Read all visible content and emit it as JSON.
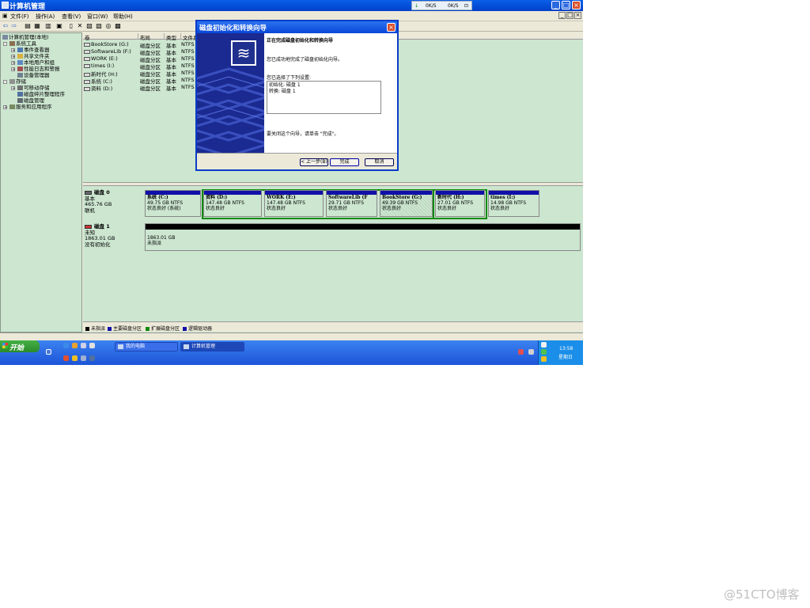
{
  "window": {
    "title": "计算机管理",
    "min_label": "_",
    "max_label": "□",
    "close_label": "×",
    "netmon": {
      "down": "0K/S",
      "up": "0K/S"
    }
  },
  "menu": [
    "文件(F)",
    "操作(A)",
    "查看(V)",
    "窗口(W)",
    "帮助(H)"
  ],
  "tree": {
    "root": "计算机管理(本地)",
    "system_tools": "系统工具",
    "event_viewer": "事件查看器",
    "shared_folders": "共享文件夹",
    "local_users": "本地用户和组",
    "perf_logs": "性能日志和警报",
    "device_manager": "设备管理器",
    "storage": "存储",
    "removable_storage": "可移动存储",
    "defrag": "磁盘碎片整理程序",
    "disk_mgmt": "磁盘管理",
    "services": "服务和应用程序"
  },
  "volume_list": {
    "columns": [
      "卷",
      "布局",
      "类型",
      "文件系"
    ],
    "rows": [
      {
        "name": "BookStore (G:)",
        "layout": "磁盘分区",
        "type": "基本",
        "fs": "NTFS"
      },
      {
        "name": "SoftwareLib (F:)",
        "layout": "磁盘分区",
        "type": "基本",
        "fs": "NTFS"
      },
      {
        "name": "WORK (E:)",
        "layout": "磁盘分区",
        "type": "基本",
        "fs": "NTFS"
      },
      {
        "name": "times (I:)",
        "layout": "磁盘分区",
        "type": "基本",
        "fs": "NTFS"
      },
      {
        "name": "新时代 (H:)",
        "layout": "磁盘分区",
        "type": "基本",
        "fs": "NTFS"
      },
      {
        "name": "系统 (C:)",
        "layout": "磁盘分区",
        "type": "基本",
        "fs": "NTFS"
      },
      {
        "name": "资料 (D:)",
        "layout": "磁盘分区",
        "type": "基本",
        "fs": "NTFS"
      }
    ]
  },
  "disk0": {
    "name": "磁盘 0",
    "kind": "基本",
    "size": "465.76 GB",
    "state": "联机",
    "partitions": [
      {
        "name": "系统  (C:)",
        "size": "49.75 GB NTFS",
        "status": "状态良好 (系统)"
      },
      {
        "name": "资料  (D:)",
        "size": "147.48 GB NTFS",
        "status": "状态良好"
      },
      {
        "name": "WORK  (E:)",
        "size": "147.48 GB NTFS",
        "status": "状态良好"
      },
      {
        "name": "SoftwareLib  (F",
        "size": "29.71 GB NTFS",
        "status": "状态良好"
      },
      {
        "name": "BookStore  (G:)",
        "size": "49.39 GB NTFS",
        "status": "状态良好"
      },
      {
        "name": "新时代  (H:)",
        "size": "27.01 GB NTFS",
        "status": "状态良好"
      },
      {
        "name": "times  (I:)",
        "size": "14.98 GB NTFS",
        "status": "状态良好"
      }
    ]
  },
  "disk1": {
    "name": "磁盘 1",
    "kind": "未知",
    "size": "1863.01 GB",
    "state": "没有初始化",
    "region_size": "1863.01 GB",
    "region_state": "未指派"
  },
  "legend": [
    "未指派",
    "主要磁盘分区",
    "扩展磁盘分区",
    "逻辑驱动器"
  ],
  "legend_colors": [
    "#000000",
    "#1010a8",
    "#108a10",
    "#1010a8"
  ],
  "dialog": {
    "title": "磁盘初始化和转换向导",
    "heading": "正在完成磁盘初始化和转换向导",
    "completed_text": "您已成功地完成了磁盘初始化向导。",
    "selected_label": "您已选择了下列设置:",
    "setting_init": "初始化: 磁盘 1",
    "setting_convert": "转换: 磁盘 1",
    "close_hint": "要关闭这个向导，请单击 \"完成\"。",
    "back_button": "< 上一步(B)",
    "finish_button": "完成",
    "cancel_button": "取消"
  },
  "taskbar": {
    "start": "开始",
    "tasks": [
      "我的电脑",
      "计算机管理"
    ],
    "clock": "13:58",
    "day": "星期日"
  },
  "watermark": "@51CTO博客"
}
